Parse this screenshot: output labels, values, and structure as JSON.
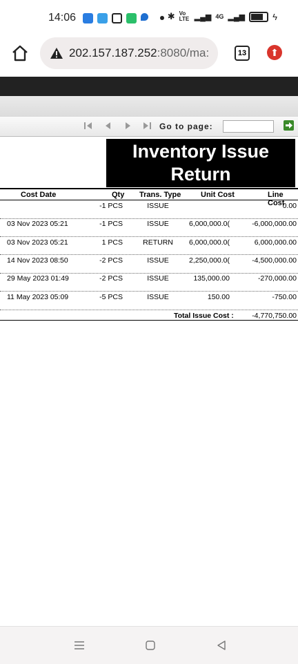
{
  "status_bar": {
    "time": "14:06",
    "network": "4G",
    "volte": "Vo LTE"
  },
  "browser": {
    "url_host": "202.157.187.252",
    "url_rest": ":8080/ma:",
    "tab_count": "13"
  },
  "pager": {
    "go_to_page_label": "Go to page:",
    "page_input_value": ""
  },
  "report": {
    "title_line1": "Inventory Issue",
    "title_line2": "Return",
    "columns": [
      "Cost Date",
      "Qty",
      "Trans. Type",
      "Unit Cost",
      "Line Cost"
    ],
    "rows": [
      {
        "date": "",
        "qty": "-1 PCS",
        "type": "ISSUE",
        "unit_cost": "",
        "line_cost": "0.00"
      },
      {
        "date": "03 Nov 2023 05:21",
        "qty": "-1 PCS",
        "type": "ISSUE",
        "unit_cost": "6,000,000.0(",
        "line_cost": "-6,000,000.00"
      },
      {
        "date": "03 Nov 2023 05:21",
        "qty": "1 PCS",
        "type": "RETURN",
        "unit_cost": "6,000,000.0(",
        "line_cost": "6,000,000.00"
      },
      {
        "date": "14 Nov 2023 08:50",
        "qty": "-2 PCS",
        "type": "ISSUE",
        "unit_cost": "2,250,000.0(",
        "line_cost": "-4,500,000.00"
      },
      {
        "date": "29 May 2023 01:49",
        "qty": "-2 PCS",
        "type": "ISSUE",
        "unit_cost": "135,000.00",
        "line_cost": "-270,000.00"
      },
      {
        "date": "11 May 2023 05:09",
        "qty": "-5 PCS",
        "type": "ISSUE",
        "unit_cost": "150.00",
        "line_cost": "-750.00"
      }
    ],
    "total_label": "Total Issue Cost :",
    "total_value": "-4,770,750.00"
  }
}
